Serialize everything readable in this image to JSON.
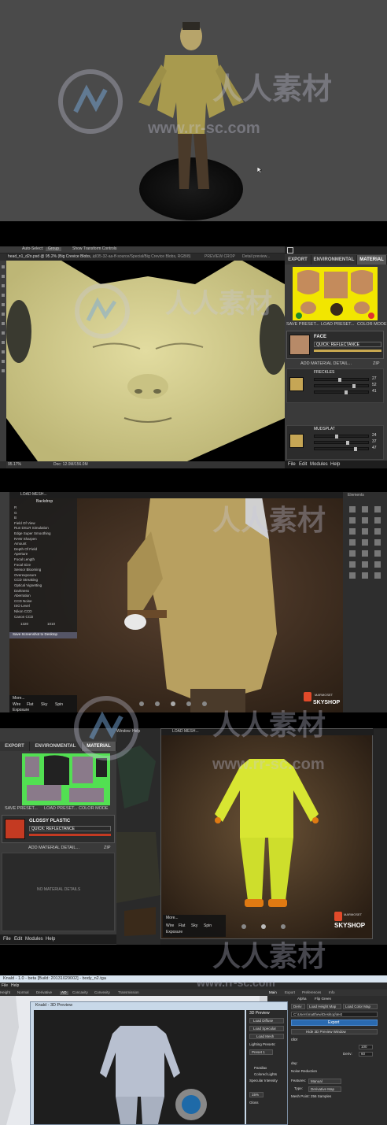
{
  "panel1": {
    "cursor": "pointer-icon"
  },
  "panel2": {
    "ps_toolbar": [
      "Auto-Select:",
      "Group",
      "Show Transform Controls"
    ],
    "ps_doc_tab": "head_n1_d2o.psd @ 95.2% (Big Crevice Blobs, ...",
    "ps_doc_tab2": "id/35-32-aa-ff-source/Special/Big Crevice Blobs, RGB/8) ",
    "ps_doc_tab3": "PREVIEW CROP",
    "ps_doc_tab4": "Detail preview...",
    "ps_status": "95.17%",
    "ps_status2": "Doc: 12.0M/156.0M",
    "tabs": [
      "EXPORT",
      "ENVIRONMENTAL",
      "MATERIAL"
    ],
    "save_preset": "SAVE PRESET...",
    "load_preset": "LOAD PRESET...",
    "color_mode": "COLOR MODE",
    "material_name": "FACE",
    "material_type": "QUICK: REFLECTANCE",
    "add_detail": "ADD MATERIAL DETAIL...",
    "zip": "ZIP",
    "detail1_name": "FRECKLES",
    "detail1_values": [
      "27",
      "52",
      "41"
    ],
    "detail2_name": "MUDSPLAT",
    "detail2_values": [
      "24",
      "37",
      "47"
    ],
    "menu": [
      "File",
      "Edit",
      "Modules",
      "Help"
    ]
  },
  "panel3": {
    "title": "LOAD MESH...",
    "side_title": "Backdrop",
    "props": [
      "R",
      "G",
      "B",
      "Field Of View",
      "Run DSLR Simulation",
      "Edge Super Smoothing",
      "RAW Sharpen",
      "Amount",
      "Depth Of Field",
      "Aperture",
      "Focal Length",
      "Focal Size",
      "Sensor Blooming",
      "Overexposure",
      "CCD Streaking",
      "Optical Vignetting",
      "Darkness",
      "Aberration",
      "CCD Noise",
      "ISO Level",
      "Nikon CCD",
      "Canon CCD",
      "1320",
      "1010"
    ],
    "save_btn": "Save Screenshot to Desktop",
    "more": "More...",
    "view_modes": [
      "Wire",
      "Flat",
      "Sky",
      "Spin"
    ],
    "exposure": "Exposure",
    "brand_small": "MARMOSET",
    "brand": "SKYSHOP",
    "right_title": "Elements"
  },
  "panel4": {
    "tabs": [
      "EXPORT",
      "ENVIRONMENTAL",
      "MATERIAL"
    ],
    "save_preset": "SAVE PRESET...",
    "load_preset": "LOAD PRESET...",
    "color_mode": "COLOR MODE",
    "material_name": "GLOSSY PLASTIC",
    "material_type": "QUICK: REFLECTANCE",
    "add_detail": "ADD MATERIAL DETAIL...",
    "zip": "ZIP",
    "no_details": "NO MATERIAL DETAILS",
    "menu": [
      "File",
      "Edit",
      "Modules",
      "Help"
    ],
    "viewer_title": "LOAD MESH...",
    "window_label": "Window",
    "help_label": "Help",
    "more": "More...",
    "view_modes": [
      "Wire",
      "Flat",
      "Sky",
      "Spin"
    ],
    "exposure": "Exposure",
    "brand_small": "MARMOSET",
    "brand": "SKYSHOP"
  },
  "panel5": {
    "window_title": "Knald - 1.0 - beta [Build: 20131029002] - body_n2.tga",
    "menu": [
      "File",
      "Help"
    ],
    "tabs": [
      "Height",
      "Normal",
      "Derivative",
      "AO",
      "Concavity",
      "Convexity",
      "Transmission"
    ],
    "right_tabs": [
      "Main",
      "Export",
      "Preferences",
      "Info"
    ],
    "opt1": "Alpha",
    "opt2": "Flip Green",
    "btn_height_map": "Load Height Map",
    "btn_color_map": "Load Color Map",
    "btn_deriv": "Deriv",
    "path": "C:\\Users\\matthew\\Desktop\\test",
    "export": "Export",
    "hide_preview": "Hide 3D Preview Window",
    "color_label": "olor",
    "val_100": "100",
    "deriv_label": "Deriv:",
    "val_60": "60",
    "day_label": "day:",
    "noise": "Noise Reduction",
    "features": "Features:",
    "manual": "Manual",
    "type": "Type:",
    "type_val": "Derivative Map",
    "mesh_point": "Mesh Point: 256 Samples",
    "preview_title": "Knald - 3D Preview",
    "preview_section": "3D Preview",
    "load_diffuse": "Load Diffuse",
    "load_specular": "Load Specular",
    "load_mesh": "Load Mesh",
    "lighting_presets": "Lighting Presets:",
    "preset": "Preset 1",
    "parallax": "Parallax",
    "colored_lights": "Colored Lights",
    "specular_intensity": "Specular Intensity",
    "val_15": "15%",
    "gloss": "Gloss"
  },
  "watermark": {
    "cn": "人人素材",
    "url": "www.rr-sc.com"
  }
}
